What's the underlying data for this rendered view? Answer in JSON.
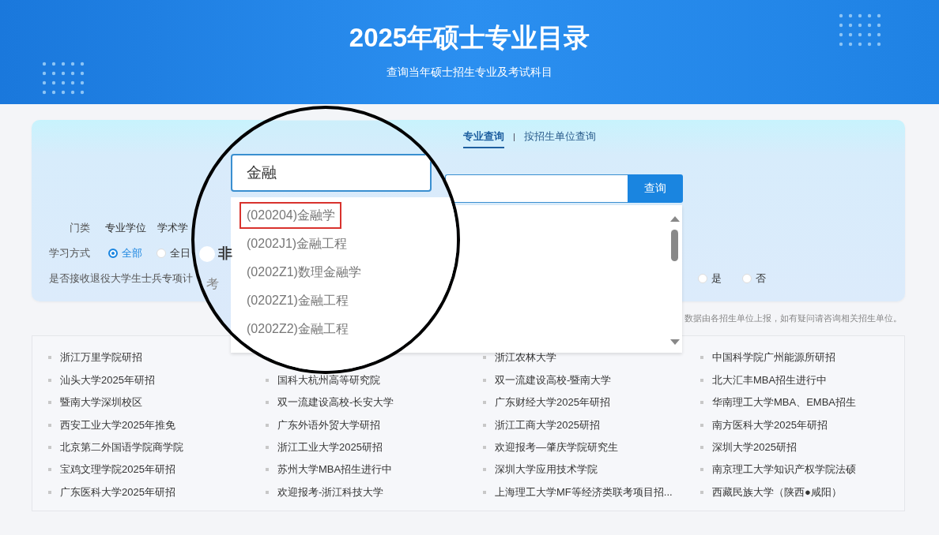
{
  "header": {
    "title": "2025年硕士专业目录",
    "subtitle": "查询当年硕士招生专业及考试科目"
  },
  "tabs": [
    {
      "label": "专业查询",
      "selected": true
    },
    {
      "label": "按招生单位查询",
      "selected": false
    }
  ],
  "search": {
    "value": "金融",
    "button": "查询"
  },
  "suggestions": [
    {
      "label": "(020204)金融学",
      "selected": true
    },
    {
      "label": "(0202J1)金融工程",
      "selected": false
    },
    {
      "label": "(0202Z1)数理金融学",
      "selected": false
    },
    {
      "label": "(0202Z1)金融工程",
      "selected": false
    },
    {
      "label": "(0202Z2)金融工程",
      "selected": false
    }
  ],
  "filters": {
    "category_label": "门类",
    "categories": [
      "专业学位",
      "学术学"
    ],
    "mode_label": "学习方式",
    "modes": [
      {
        "label": "全部",
        "selected": true
      },
      {
        "label": "全日",
        "selected": false
      },
      {
        "label": "非",
        "selected": false
      }
    ],
    "veteran_label": "是否接收退役大学生士兵专项计",
    "fragment": "考",
    "veteran_options": [
      {
        "label": "是",
        "selected": false
      },
      {
        "label": "否",
        "selected": false
      }
    ]
  },
  "notice": "数据由各招生单位上报，如有疑问请咨询相关招生单位。",
  "links": [
    [
      "浙江万里学院研招",
      "汕头大学2025年研招",
      "暨南大学深圳校区",
      "西安工业大学2025年推免",
      "北京第二外国语学院商学院",
      "宝鸡文理学院2025年研招",
      "广东医科大学2025年研招"
    ],
    [
      "国科大杭州高等研究院",
      "双一流建设高校-长安大学",
      "广东外语外贸大学研招",
      "浙江工业大学2025研招",
      "苏州大学MBA招生进行中",
      "欢迎报考-浙江科技大学"
    ],
    [
      "浙江农林大学",
      "双一流建设高校-暨南大学",
      "广东财经大学2025年研招",
      "浙江工商大学2025研招",
      "欢迎报考—肇庆学院研究生",
      "深圳大学应用技术学院",
      "上海理工大学MF等经济类联考项目招..."
    ],
    [
      "中国科学院广州能源所研招",
      "北大汇丰MBA招生进行中",
      "华南理工大学MBA、EMBA招生",
      "南方医科大学2025年研招",
      "深圳大学2025研招",
      "南京理工大学知识产权学院法硕",
      "西藏民族大学（陕西●咸阳）"
    ]
  ]
}
